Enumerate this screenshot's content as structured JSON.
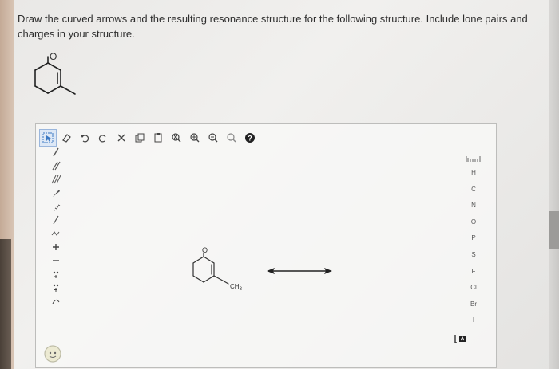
{
  "question": {
    "text": "Draw the curved arrows and the resulting resonance structure for the following structure. Include lone pairs and charges in your structure."
  },
  "structure": {
    "top_atom_label": "O",
    "canvas_atom_label": "O",
    "substituent_label": "CH3"
  },
  "toolbar": {
    "items": [
      {
        "name": "select-arrow-icon",
        "glyph": "select"
      },
      {
        "name": "eraser-icon",
        "glyph": "erase"
      },
      {
        "name": "undo-icon",
        "glyph": "undo"
      },
      {
        "name": "redo-icon",
        "glyph": "redo"
      },
      {
        "name": "cut-icon",
        "glyph": "cut"
      },
      {
        "name": "copy-icon",
        "glyph": "copy"
      },
      {
        "name": "paste-icon",
        "glyph": "paste"
      },
      {
        "name": "zoom-reset-icon",
        "glyph": "zoomx"
      },
      {
        "name": "zoom-in-icon",
        "glyph": "zoomin"
      },
      {
        "name": "zoom-out-icon",
        "glyph": "zoomout"
      },
      {
        "name": "zoom-fit-icon",
        "glyph": "zoomfit"
      },
      {
        "name": "help-icon",
        "glyph": "help"
      }
    ]
  },
  "left_tools": {
    "items": [
      {
        "name": "single-bond-tool",
        "glyph": "/"
      },
      {
        "name": "double-bond-tool",
        "glyph": "//"
      },
      {
        "name": "triple-bond-tool",
        "glyph": "///"
      },
      {
        "name": "wedge-bond-tool",
        "glyph": "wedge"
      },
      {
        "name": "hash-bond-tool",
        "glyph": "hash"
      },
      {
        "name": "wavy-bond-tool",
        "glyph": "/"
      },
      {
        "name": "chain-tool",
        "glyph": "ww"
      },
      {
        "name": "plus-charge-tool",
        "glyph": "+"
      },
      {
        "name": "minus-charge-tool",
        "glyph": "−"
      },
      {
        "name": "lone-pair-tool",
        "glyph": "dots"
      },
      {
        "name": "radical-tool",
        "glyph": "dots2"
      },
      {
        "name": "arrow-tool",
        "glyph": "arrow"
      }
    ]
  },
  "elements": {
    "items": [
      "H",
      "C",
      "N",
      "O",
      "P",
      "S",
      "F",
      "Cl",
      "Br",
      "I"
    ]
  },
  "colors": {
    "accent": "#3a78c3",
    "text": "#2e2e2e"
  }
}
